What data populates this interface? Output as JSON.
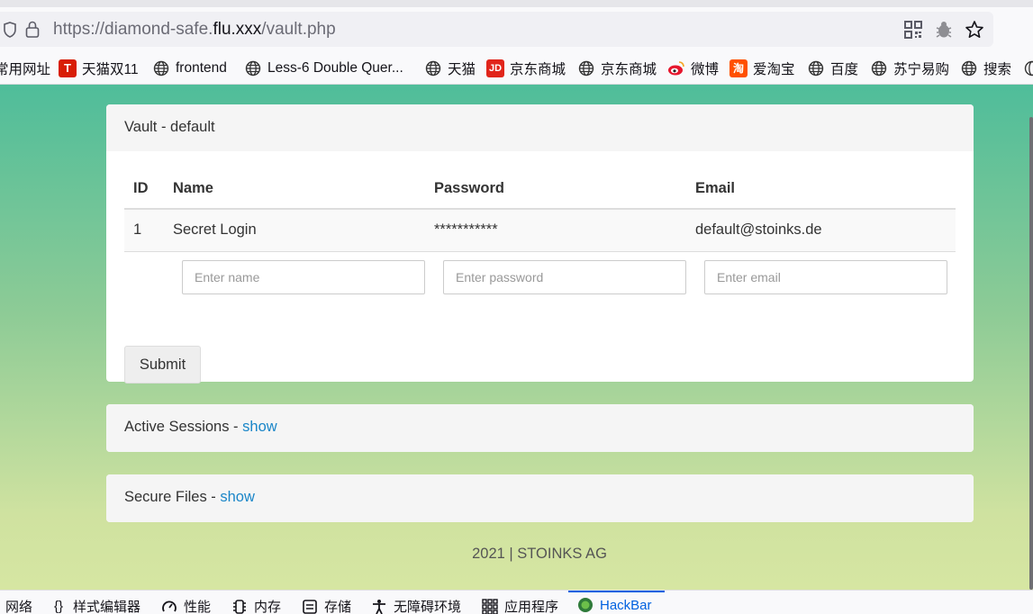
{
  "browser": {
    "url_prefix": "https://diamond-safe.",
    "url_domain": "flu.xxx",
    "url_path": "/vault.php",
    "icons": [
      "shield-icon",
      "lock-icon",
      "qr-code-icon",
      "extension-bug-icon",
      "bookmark-star-icon"
    ]
  },
  "bookmarks": [
    {
      "label": "常用网址",
      "icon": "none"
    },
    {
      "label": "天猫双11",
      "icon": "tmall-icon"
    },
    {
      "label": "frontend",
      "icon": "globe-icon"
    },
    {
      "label": "Less-6 Double Quer...",
      "icon": "globe-icon"
    },
    {
      "label": "天猫",
      "icon": "globe-icon"
    },
    {
      "label": "京东商城",
      "icon": "jd-icon"
    },
    {
      "label": "京东商城",
      "icon": "globe-icon"
    },
    {
      "label": "微博",
      "icon": "weibo-icon"
    },
    {
      "label": "爱淘宝",
      "icon": "taobao-icon"
    },
    {
      "label": "百度",
      "icon": "globe-icon"
    },
    {
      "label": "苏宁易购",
      "icon": "globe-icon"
    },
    {
      "label": "搜索",
      "icon": "globe-icon"
    }
  ],
  "vault": {
    "title": "Vault - default",
    "columns": [
      "ID",
      "Name",
      "Password",
      "Email"
    ],
    "rows": [
      {
        "id": "1",
        "name": "Secret Login",
        "password": "***********",
        "email": "default@stoinks.de"
      }
    ],
    "placeholders": {
      "name": "Enter name",
      "password": "Enter password",
      "email": "Enter email"
    },
    "submit_label": "Submit"
  },
  "sessions": {
    "title": "Active Sessions - ",
    "link": "show"
  },
  "files": {
    "title": "Secure Files - ",
    "link": "show"
  },
  "footer": "2021 | STOINKS AG",
  "devtools": [
    {
      "label": "网络",
      "icon": "network-icon"
    },
    {
      "label": "样式编辑器",
      "icon": "braces-icon"
    },
    {
      "label": "性能",
      "icon": "gauge-icon"
    },
    {
      "label": "内存",
      "icon": "memory-chip-icon"
    },
    {
      "label": "存储",
      "icon": "storage-icon"
    },
    {
      "label": "无障碍环境",
      "icon": "accessibility-icon"
    },
    {
      "label": "应用程序",
      "icon": "apps-grid-icon"
    },
    {
      "label": "HackBar",
      "icon": "hackbar-icon",
      "active": true
    }
  ],
  "colors": {
    "link": "#1a86c8",
    "active_tab": "#0061e0",
    "gradient_top": "#4fbd9a",
    "gradient_bottom": "#d6e6a2"
  }
}
